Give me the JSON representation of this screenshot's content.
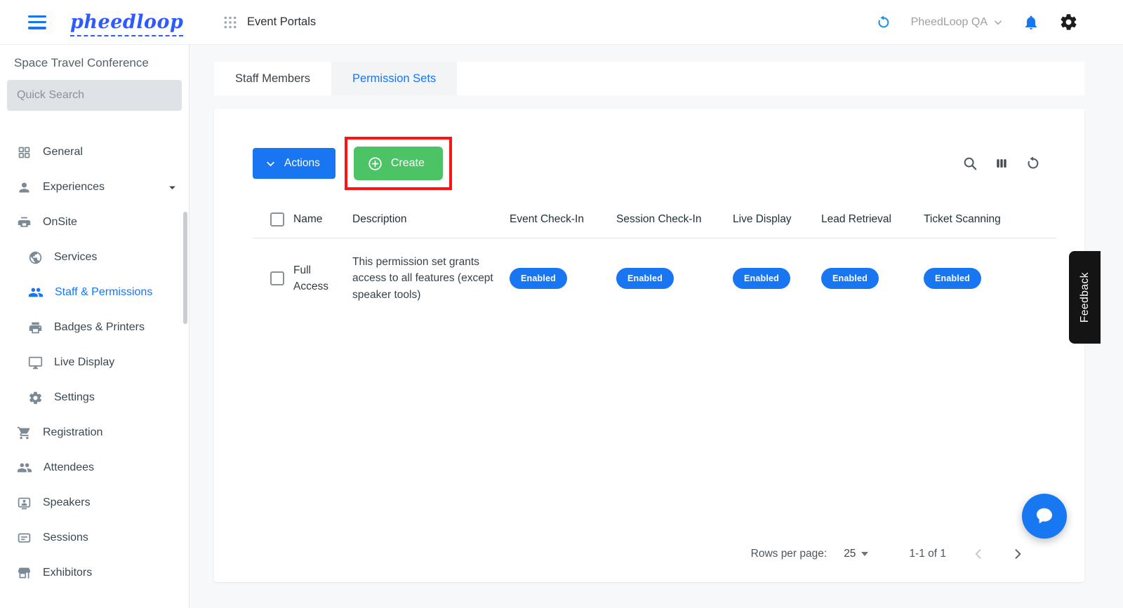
{
  "topbar": {
    "logo": "pheedloop",
    "page_title": "Event Portals",
    "account": "PheedLoop QA"
  },
  "sidebar": {
    "event_name": "Space Travel Conference",
    "search_placeholder": "Quick Search",
    "items": [
      {
        "label": "General",
        "icon": "grid"
      },
      {
        "label": "Experiences",
        "icon": "person",
        "expandable": true
      },
      {
        "label": "OnSite",
        "icon": "kiosk"
      },
      {
        "label": "Services",
        "icon": "globe"
      },
      {
        "label": "Staff & Permissions",
        "icon": "people",
        "active": true
      },
      {
        "label": "Badges & Printers",
        "icon": "printer"
      },
      {
        "label": "Live Display",
        "icon": "monitor"
      },
      {
        "label": "Settings",
        "icon": "gear"
      },
      {
        "label": "Registration",
        "icon": "cart"
      },
      {
        "label": "Attendees",
        "icon": "people"
      },
      {
        "label": "Speakers",
        "icon": "person-board"
      },
      {
        "label": "Sessions",
        "icon": "presentation"
      },
      {
        "label": "Exhibitors",
        "icon": "storefront"
      }
    ]
  },
  "tabs": {
    "staff_members": "Staff Members",
    "permission_sets": "Permission Sets"
  },
  "toolbar": {
    "actions_label": "Actions",
    "create_label": "Create"
  },
  "table": {
    "columns": [
      "Name",
      "Description",
      "Event Check-In",
      "Session Check-In",
      "Live Display",
      "Lead Retrieval",
      "Ticket Scanning"
    ],
    "rows": [
      {
        "name": "Full Access",
        "description": "This permission set grants access to all features (except speaker tools)",
        "statuses": [
          "Enabled",
          "Enabled",
          "Enabled",
          "Enabled",
          "Enabled"
        ]
      }
    ]
  },
  "pagination": {
    "rows_per_page_label": "Rows per page:",
    "rows_per_page_value": "25",
    "range": "1-1 of 1"
  },
  "feedback": {
    "label": "Feedback"
  },
  "colors": {
    "primary_blue": "#1976f2",
    "logo_blue": "#2d5bff",
    "create_green": "#4cc365",
    "annotation_red": "#fb1414",
    "pill_blue": "#1976f2",
    "feedback_black": "#141414",
    "chat_blue": "#1778f2"
  }
}
